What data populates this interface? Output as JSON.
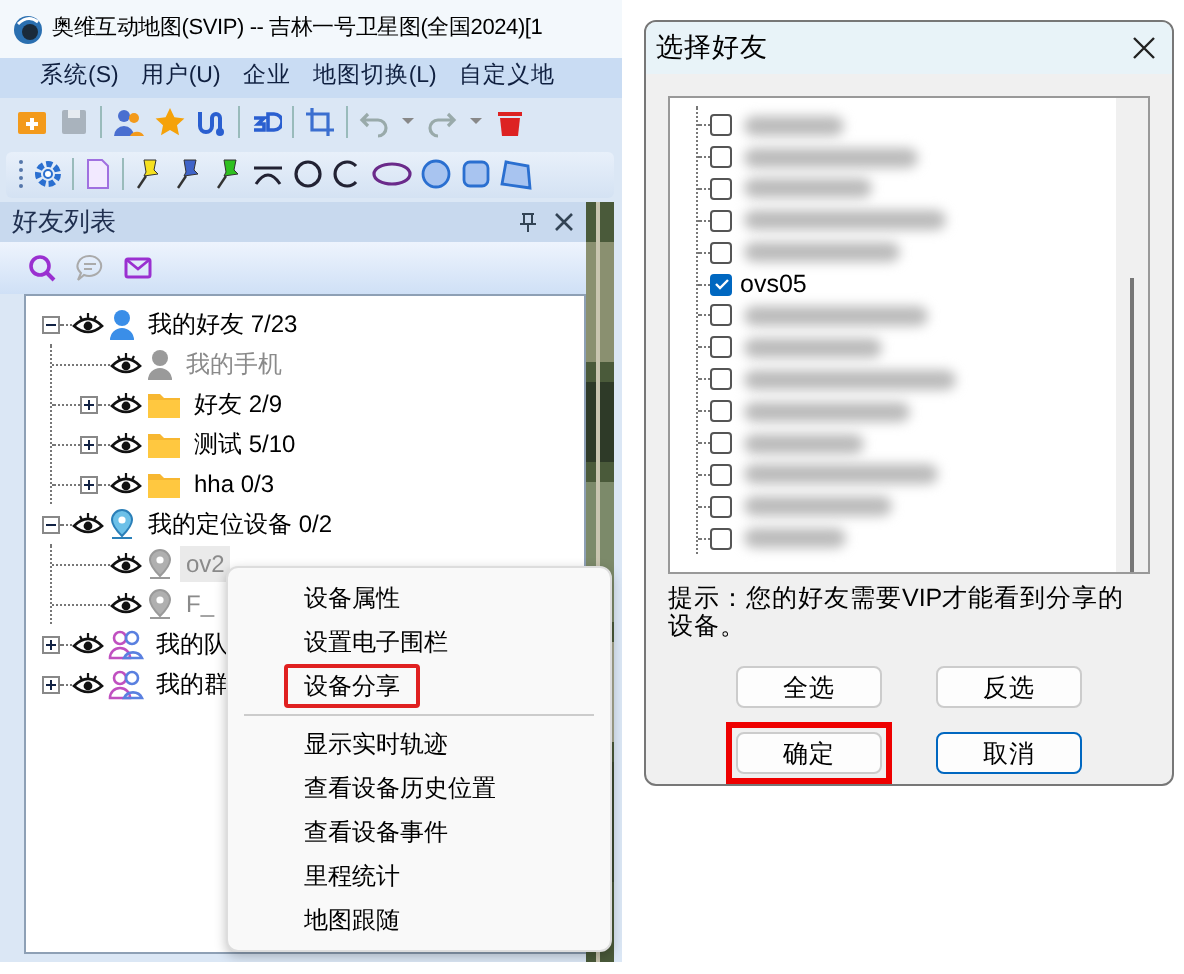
{
  "window": {
    "title": "奥维互动地图(SVIP) -- 吉林一号卫星图(全国2024)[1"
  },
  "menu": [
    {
      "label": "系统",
      "key": "(S)"
    },
    {
      "label": "用户",
      "key": "(U)"
    },
    {
      "label": "企业"
    },
    {
      "label": "地图切换",
      "key": "(L)"
    },
    {
      "label": "自定义地"
    }
  ],
  "panel": {
    "title": "好友列表"
  },
  "tree": [
    {
      "label": "我的好友 7/23",
      "kind": "user",
      "expanded": true,
      "selected": false,
      "children": [
        {
          "label": "我的手机",
          "kind": "user",
          "offline": true,
          "selected": false
        },
        {
          "label": "好友 2/9",
          "kind": "folder",
          "expanded": false,
          "selected": false
        },
        {
          "label": "测试 5/10",
          "kind": "folder",
          "expanded": false,
          "selected": false
        },
        {
          "label": "hha 0/3",
          "kind": "folder",
          "expanded": false,
          "selected": false
        }
      ]
    },
    {
      "label": "我的定位设备 0/2",
      "kind": "device",
      "expanded": true,
      "selected": false,
      "children": [
        {
          "label": "ov2",
          "kind": "device",
          "offline": true,
          "selected": true
        },
        {
          "label": "F_",
          "kind": "device",
          "offline": true,
          "selected": false
        }
      ]
    },
    {
      "label": "我的队",
      "kind": "group",
      "expanded": false,
      "selected": false
    },
    {
      "label": "我的群",
      "kind": "group",
      "expanded": false,
      "selected": false
    }
  ],
  "context_menu": [
    {
      "kind": "item",
      "label": "设备属性",
      "highlighted": false
    },
    {
      "kind": "item",
      "label": "设置电子围栏",
      "highlighted": false
    },
    {
      "kind": "item",
      "label": "设备分享",
      "highlighted": true
    },
    {
      "kind": "separator"
    },
    {
      "kind": "item",
      "label": "显示实时轨迹",
      "highlighted": false
    },
    {
      "kind": "item",
      "label": "查看设备历史位置",
      "highlighted": false
    },
    {
      "kind": "item",
      "label": "查看设备事件",
      "highlighted": false
    },
    {
      "kind": "item",
      "label": "里程统计",
      "highlighted": false
    },
    {
      "kind": "item",
      "label": "地图跟随",
      "highlighted": false
    }
  ],
  "dialog": {
    "title": "选择好友",
    "friends": [
      {
        "kind": "redacted",
        "checked": false
      },
      {
        "kind": "redacted",
        "checked": false
      },
      {
        "kind": "redacted",
        "checked": false
      },
      {
        "kind": "redacted",
        "checked": false
      },
      {
        "kind": "redacted",
        "checked": false
      },
      {
        "kind": "item",
        "label": "ovs05",
        "checked": true
      },
      {
        "kind": "redacted",
        "checked": false
      },
      {
        "kind": "redacted",
        "checked": false
      },
      {
        "kind": "redacted",
        "checked": false
      },
      {
        "kind": "redacted",
        "checked": false
      },
      {
        "kind": "redacted",
        "checked": false
      },
      {
        "kind": "redacted",
        "checked": false
      },
      {
        "kind": "redacted",
        "checked": false
      },
      {
        "kind": "redacted",
        "checked": false
      }
    ],
    "hint": "提示：您的好友需要VIP才能看到分享的设备。",
    "buttons": [
      {
        "label": "全选",
        "default": false,
        "highlighted": false
      },
      {
        "label": "反选",
        "default": false,
        "highlighted": false
      },
      {
        "label": "确定",
        "default": false,
        "highlighted": true
      },
      {
        "label": "取消",
        "default": true,
        "highlighted": false
      }
    ]
  }
}
